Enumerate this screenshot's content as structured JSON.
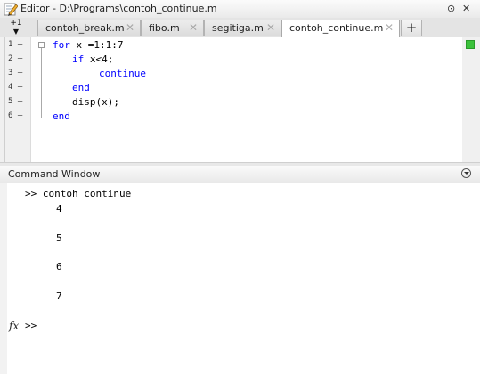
{
  "editor": {
    "title": "Editor - D:\\Programs\\contoh_continue.m",
    "title_icons": [
      "⊙",
      "✕"
    ],
    "tab_control": "+1",
    "tabs": [
      {
        "label": "contoh_break.m",
        "active": false
      },
      {
        "label": "fibo.m",
        "active": false
      },
      {
        "label": "segitiga.m",
        "active": false
      },
      {
        "label": "contoh_continue.m",
        "active": true
      }
    ],
    "tab_close": "✕",
    "tab_add": "+",
    "line_numbers": [
      "1 –",
      "2 –",
      "3 –",
      "4 –",
      "5 –",
      "6 –"
    ],
    "code": {
      "line1_kw": "for",
      "line1_rest": " x =1:1:7",
      "line2_kw": "if",
      "line2_rest": " x<4;",
      "line3_kw": "continue",
      "line4_kw": "end",
      "line5_text": "disp(x);",
      "line6_kw": "end"
    },
    "status_color": "#3cc23c"
  },
  "command_window": {
    "title": "Command Window",
    "prompt_line": ">> contoh_continue",
    "outputs": [
      "4",
      "5",
      "6",
      "7"
    ],
    "fx_label": "fx",
    "input_prompt": ">>"
  }
}
